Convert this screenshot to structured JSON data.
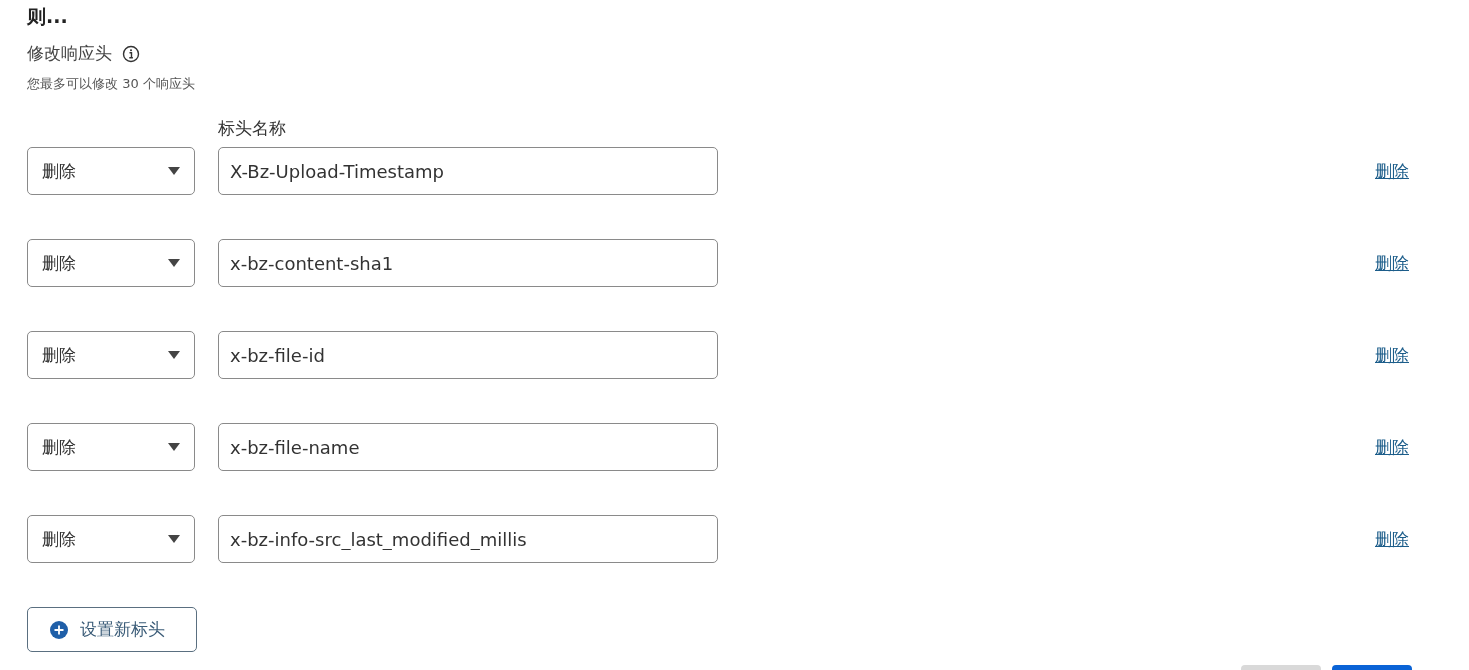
{
  "heading": "则...",
  "section": {
    "title": "修改响应头",
    "note": "您最多可以修改 30 个响应头"
  },
  "column_label": "标头名称",
  "rows": [
    {
      "action": "删除",
      "header": "X-Bz-Upload-Timestamp",
      "remove": "删除"
    },
    {
      "action": "删除",
      "header": "x-bz-content-sha1",
      "remove": "删除"
    },
    {
      "action": "删除",
      "header": "x-bz-file-id",
      "remove": "删除"
    },
    {
      "action": "删除",
      "header": "x-bz-file-name",
      "remove": "删除"
    },
    {
      "action": "删除",
      "header": "x-bz-info-src_last_modified_millis",
      "remove": "删除"
    }
  ],
  "add_button": "设置新标头"
}
